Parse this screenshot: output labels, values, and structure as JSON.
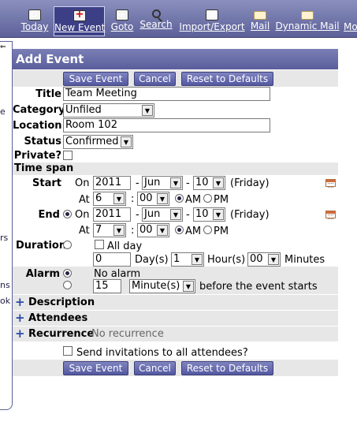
{
  "toolbar": {
    "items": [
      {
        "label": "Today",
        "icon": "home-icon"
      },
      {
        "label": "New Event",
        "icon": "new-event-icon"
      },
      {
        "label": "Goto",
        "icon": "goto-icon"
      },
      {
        "label": "Search",
        "icon": "search-icon"
      },
      {
        "label": "Import/Export",
        "icon": "import-export-icon"
      },
      {
        "label": "Mail",
        "icon": "mail-icon"
      },
      {
        "label": "Dynamic Mail",
        "icon": "mail-icon"
      },
      {
        "label": "Mo",
        "icon": "more-icon"
      }
    ]
  },
  "sidebar": {
    "fragments": [
      "e",
      "rs",
      "ns",
      "ok"
    ]
  },
  "panel": {
    "title": "Add Event",
    "buttons": {
      "save": "Save Event",
      "cancel": "Cancel",
      "reset": "Reset to Defaults"
    },
    "fields": {
      "title_label": "Title",
      "title_value": "Team Meeting",
      "category_label": "Category",
      "category_value": "Unfiled",
      "location_label": "Location",
      "location_value": "Room 102",
      "status_label": "Status",
      "status_value": "Confirmed",
      "private_label": "Private?"
    },
    "time_span": {
      "header": "Time span",
      "start_label": "Start",
      "end_label": "End",
      "on": "On",
      "at": "At",
      "start_year": "2011",
      "start_month": "Jun",
      "start_day": "10",
      "start_weekday": "(Friday)",
      "start_hour": "6",
      "start_minute": "00",
      "end_year": "2011",
      "end_month": "Jun",
      "end_day": "10",
      "end_weekday": "(Friday)",
      "end_hour": "7",
      "end_minute": "00",
      "am": "AM",
      "pm": "PM",
      "dash": "-",
      "colon": ":",
      "duration_label": "Duration",
      "all_day": "All day",
      "duration_days": "0",
      "days_label": "Day(s)",
      "duration_hours": "1",
      "hours_label": "Hour(s)",
      "duration_minutes": "00",
      "minutes_label": "Minutes"
    },
    "alarm": {
      "label": "Alarm",
      "no_alarm": "No alarm",
      "amount": "15",
      "unit": "Minute(s)",
      "suffix": "before the event starts"
    },
    "sections": {
      "description": "Description",
      "attendees": "Attendees",
      "recurrence": "Recurrence",
      "recurrence_value": "No recurrence"
    },
    "invite": "Send invitations to all attendees?"
  },
  "colors": {
    "toolbar": "#5d6199",
    "header": "#5a5e9c",
    "button": "#5458a0",
    "shade": "#e7e7e7"
  }
}
